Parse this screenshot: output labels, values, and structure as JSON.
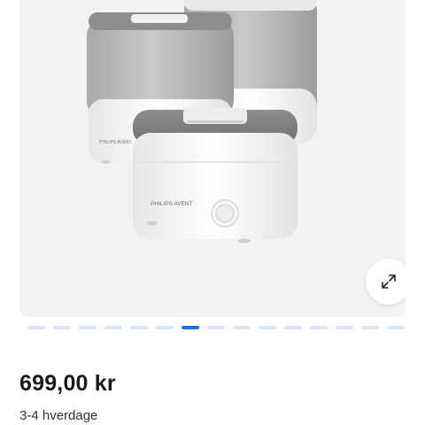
{
  "gallery": {
    "brand_label": "PHILIPS AVENT",
    "expand_icon": "expand-arrows-icon",
    "slide_count": 15,
    "active_slide": 7
  },
  "product": {
    "price": "699,00 kr",
    "delivery": "3-4 hverdage"
  },
  "colors": {
    "accent": "#1673e0",
    "dot_inactive": "#dbe6f4",
    "image_bg": "#f2f2f2"
  }
}
